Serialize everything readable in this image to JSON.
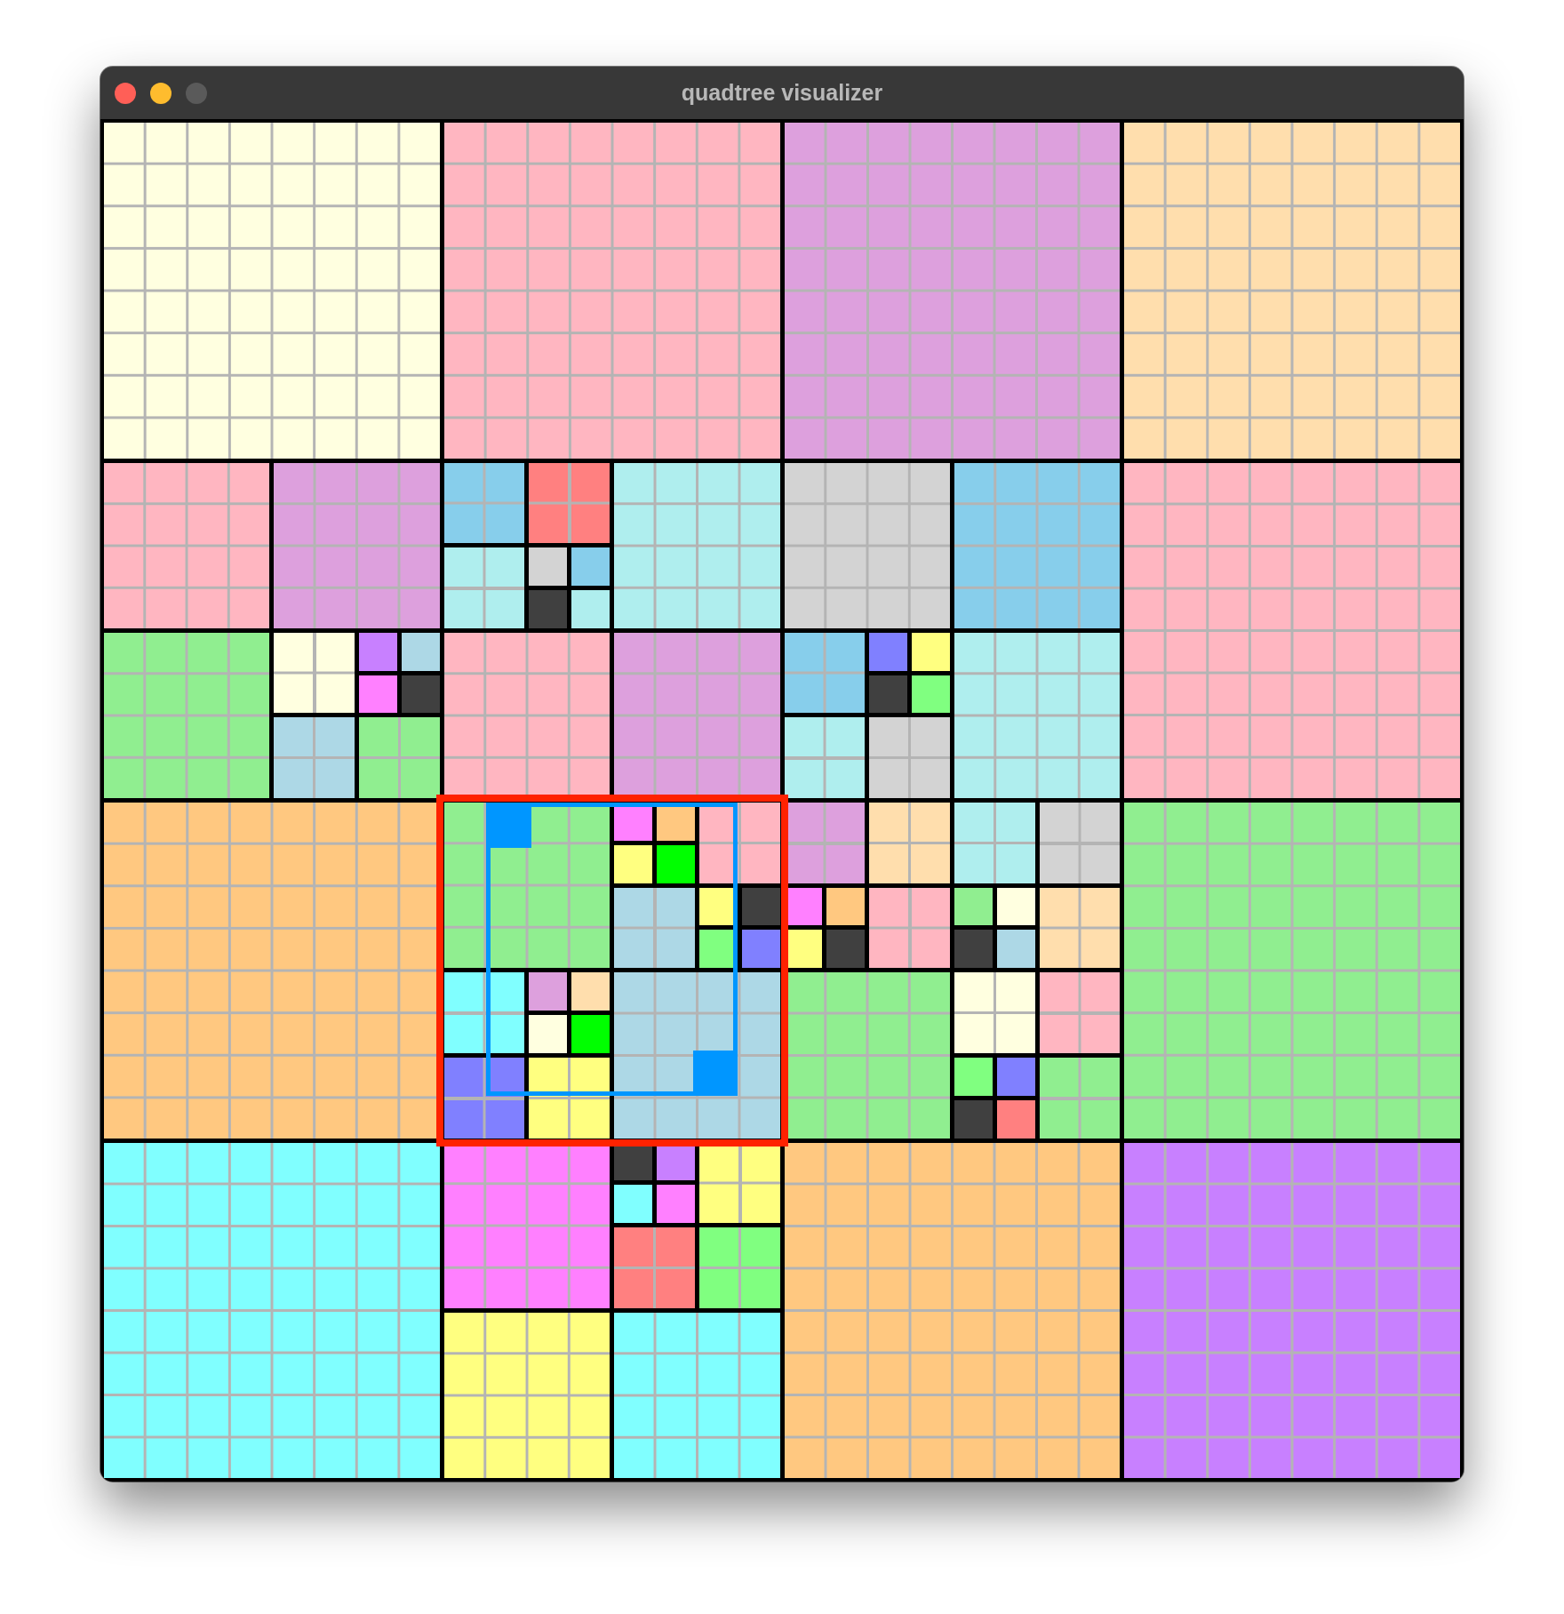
{
  "window": {
    "title": "quadtree visualizer",
    "zoom_button_enabled": false
  },
  "query_rect": {
    "visible": true
  },
  "root": {
    "children": [
      {
        "children": [
          {
            "color": "#ffffe0"
          },
          {
            "color": "#ffb6c1"
          },
          {
            "children": [
              {
                "color": "#ffb6c1"
              },
              {
                "color": "#dda0dd"
              },
              {
                "color": "#90ee90"
              },
              {
                "children": [
                  {
                    "color": "#ffffe0"
                  },
                  {
                    "children": [
                      {
                        "color": "#c880ff"
                      },
                      {
                        "color": "#add8e6"
                      },
                      {
                        "color": "#ff80ff"
                      },
                      {
                        "color": "#404040"
                      }
                    ]
                  },
                  {
                    "color": "#add8e6"
                  },
                  {
                    "color": "#90ee90"
                  }
                ]
              }
            ]
          },
          {
            "children": [
              {
                "children": [
                  {
                    "color": "#87ceeb"
                  },
                  {
                    "color": "#ff8080"
                  },
                  {
                    "color": "#afeeee"
                  },
                  {
                    "children": [
                      {
                        "color": "#d3d3d3"
                      },
                      {
                        "color": "#87ceeb"
                      },
                      {
                        "color": "#404040"
                      },
                      {
                        "color": "#afeeee"
                      }
                    ]
                  }
                ]
              },
              {
                "color": "#afeeee"
              },
              {
                "color": "#ffb6c1"
              },
              {
                "color": "#dda0dd"
              }
            ]
          }
        ]
      },
      {
        "children": [
          {
            "color": "#dda0dd"
          },
          {
            "color": "#ffdead"
          },
          {
            "children": [
              {
                "color": "#d3d3d3"
              },
              {
                "color": "#87ceeb"
              },
              {
                "children": [
                  {
                    "color": "#87ceeb"
                  },
                  {
                    "children": [
                      {
                        "color": "#8080ff"
                      },
                      {
                        "color": "#ffff80"
                      },
                      {
                        "color": "#404040"
                      },
                      {
                        "color": "#80ff80"
                      }
                    ]
                  },
                  {
                    "color": "#afeeee"
                  },
                  {
                    "color": "#d3d3d3"
                  }
                ]
              },
              {
                "color": "#afeeee"
              }
            ]
          },
          {
            "color": "#ffb6c1"
          }
        ]
      },
      {
        "children": [
          {
            "color": "#ffc880"
          },
          {
            "highlighted": true,
            "children": [
              {
                "color": "#90ee90"
              },
              {
                "children": [
                  {
                    "children": [
                      {
                        "color": "#ff80ff"
                      },
                      {
                        "color": "#ffc880"
                      },
                      {
                        "color": "#ffff80"
                      },
                      {
                        "color": "#00ff00"
                      }
                    ]
                  },
                  {
                    "color": "#ffb6c1"
                  },
                  {
                    "color": "#add8e6"
                  },
                  {
                    "children": [
                      {
                        "color": "#ffff80"
                      },
                      {
                        "color": "#404040"
                      },
                      {
                        "color": "#80ff80"
                      },
                      {
                        "color": "#8080ff"
                      }
                    ]
                  }
                ]
              },
              {
                "children": [
                  {
                    "color": "#80ffff"
                  },
                  {
                    "children": [
                      {
                        "color": "#dda0dd"
                      },
                      {
                        "color": "#ffdead"
                      },
                      {
                        "color": "#ffffe0"
                      },
                      {
                        "color": "#00ff00"
                      }
                    ]
                  },
                  {
                    "color": "#8080ff"
                  },
                  {
                    "color": "#ffff80"
                  }
                ]
              },
              {
                "color": "#add8e6"
              }
            ]
          },
          {
            "color": "#80ffff"
          },
          {
            "children": [
              {
                "color": "#ff80ff"
              },
              {
                "children": [
                  {
                    "children": [
                      {
                        "color": "#404040"
                      },
                      {
                        "color": "#c880ff"
                      },
                      {
                        "color": "#80ffff"
                      },
                      {
                        "color": "#ff80ff"
                      }
                    ]
                  },
                  {
                    "color": "#ffff80"
                  },
                  {
                    "color": "#ff8080"
                  },
                  {
                    "color": "#80ff80"
                  }
                ]
              },
              {
                "color": "#ffff80"
              },
              {
                "color": "#80ffff"
              }
            ]
          }
        ]
      },
      {
        "children": [
          {
            "children": [
              {
                "children": [
                  {
                    "color": "#dda0dd"
                  },
                  {
                    "color": "#ffdead"
                  },
                  {
                    "children": [
                      {
                        "color": "#ff80ff"
                      },
                      {
                        "color": "#ffc880"
                      },
                      {
                        "color": "#ffff80"
                      },
                      {
                        "color": "#404040"
                      }
                    ]
                  },
                  {
                    "color": "#ffb6c1"
                  }
                ]
              },
              {
                "children": [
                  {
                    "color": "#afeeee"
                  },
                  {
                    "color": "#d3d3d3"
                  },
                  {
                    "children": [
                      {
                        "color": "#90ee90"
                      },
                      {
                        "color": "#ffffe0"
                      },
                      {
                        "color": "#404040"
                      },
                      {
                        "color": "#add8e6"
                      }
                    ]
                  },
                  {
                    "color": "#ffdead"
                  }
                ]
              },
              {
                "color": "#90ee90"
              },
              {
                "children": [
                  {
                    "color": "#ffffe0"
                  },
                  {
                    "color": "#ffb6c1"
                  },
                  {
                    "children": [
                      {
                        "color": "#80ff80"
                      },
                      {
                        "color": "#8080ff"
                      },
                      {
                        "color": "#404040"
                      },
                      {
                        "color": "#ff8080"
                      }
                    ]
                  },
                  {
                    "color": "#90ee90"
                  }
                ]
              }
            ]
          },
          {
            "color": "#90ee90"
          },
          {
            "color": "#ffc880"
          },
          {
            "color": "#c880ff"
          }
        ]
      }
    ]
  }
}
